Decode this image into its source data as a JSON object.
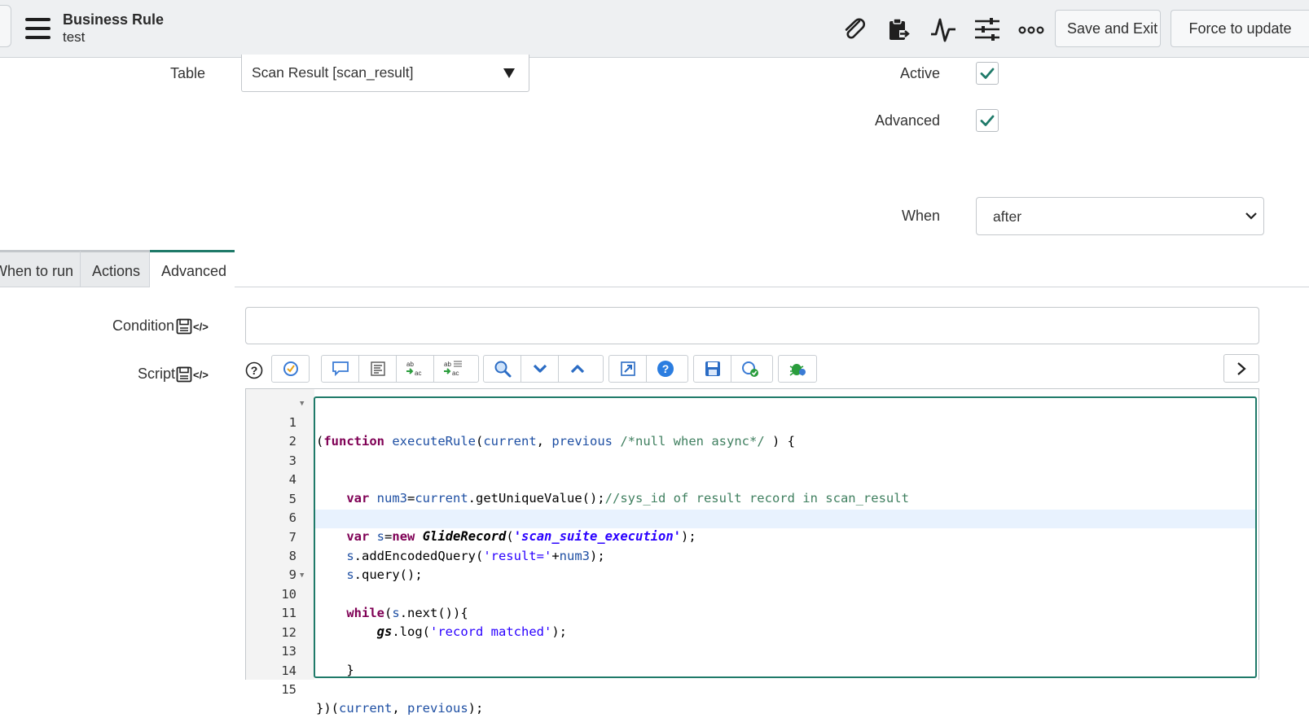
{
  "header": {
    "title": "Business Rule",
    "subtitle": "test",
    "save_exit_label": "Save and Exit",
    "force_update_label": "Force to update"
  },
  "form": {
    "table_label": "Table",
    "table_value": "Scan Result [scan_result]",
    "active_label": "Active",
    "active_checked": true,
    "advanced_label": "Advanced",
    "advanced_checked": true,
    "when_label": "When",
    "when_value": "after"
  },
  "tabs": [
    {
      "label": "When to run",
      "active": false
    },
    {
      "label": "Actions",
      "active": false
    },
    {
      "label": "Advanced",
      "active": true
    }
  ],
  "advanced": {
    "condition_label": "Condition",
    "script_label": "Script",
    "code_tag": "</>"
  },
  "script": {
    "lines": [
      {
        "n": "1",
        "fold": true
      },
      {
        "n": "2"
      },
      {
        "n": "3"
      },
      {
        "n": "4"
      },
      {
        "n": "5"
      },
      {
        "n": "6"
      },
      {
        "n": "7",
        "highlight": true
      },
      {
        "n": "8"
      },
      {
        "n": "9"
      },
      {
        "n": "10",
        "fold": true
      },
      {
        "n": "11"
      },
      {
        "n": "12"
      },
      {
        "n": "13"
      },
      {
        "n": "14"
      },
      {
        "n": "15"
      }
    ],
    "tokens": {
      "l1": [
        "(",
        "function",
        " ",
        "executeRule",
        "(",
        "current",
        ", ",
        "previous",
        " ",
        "/*null when async*/",
        " ) {"
      ],
      "l4": [
        "    ",
        "var",
        " ",
        "num3",
        "=",
        "current",
        ".getUniqueValue();",
        "//sys_id of result record in scan_result"
      ],
      "l6": [
        "    ",
        "var",
        " ",
        "s",
        "=",
        "new",
        " ",
        "GlideRecord",
        "(",
        "'scan_suite_execution'",
        ");"
      ],
      "l7": [
        "    ",
        "s",
        ".addEncodedQuery(",
        "'result='",
        "+",
        "num3",
        ");"
      ],
      "l8": [
        "    ",
        "s",
        ".query();"
      ],
      "l10": [
        "    ",
        "while",
        "(",
        "s",
        ".next()){"
      ],
      "l11": [
        "        ",
        "gs",
        ".log(",
        "'record matched'",
        ");"
      ],
      "l13": [
        "    ",
        "}"
      ],
      "l15": [
        "})(",
        "current",
        ", ",
        "previous",
        ");"
      ]
    }
  },
  "colors": {
    "accent": "#1f7a69",
    "header_bg": "#eef0f2"
  },
  "icons": [
    "menu-icon",
    "paperclip-icon",
    "clipboard-icon",
    "activity-icon",
    "sliders-icon",
    "more-icon"
  ]
}
